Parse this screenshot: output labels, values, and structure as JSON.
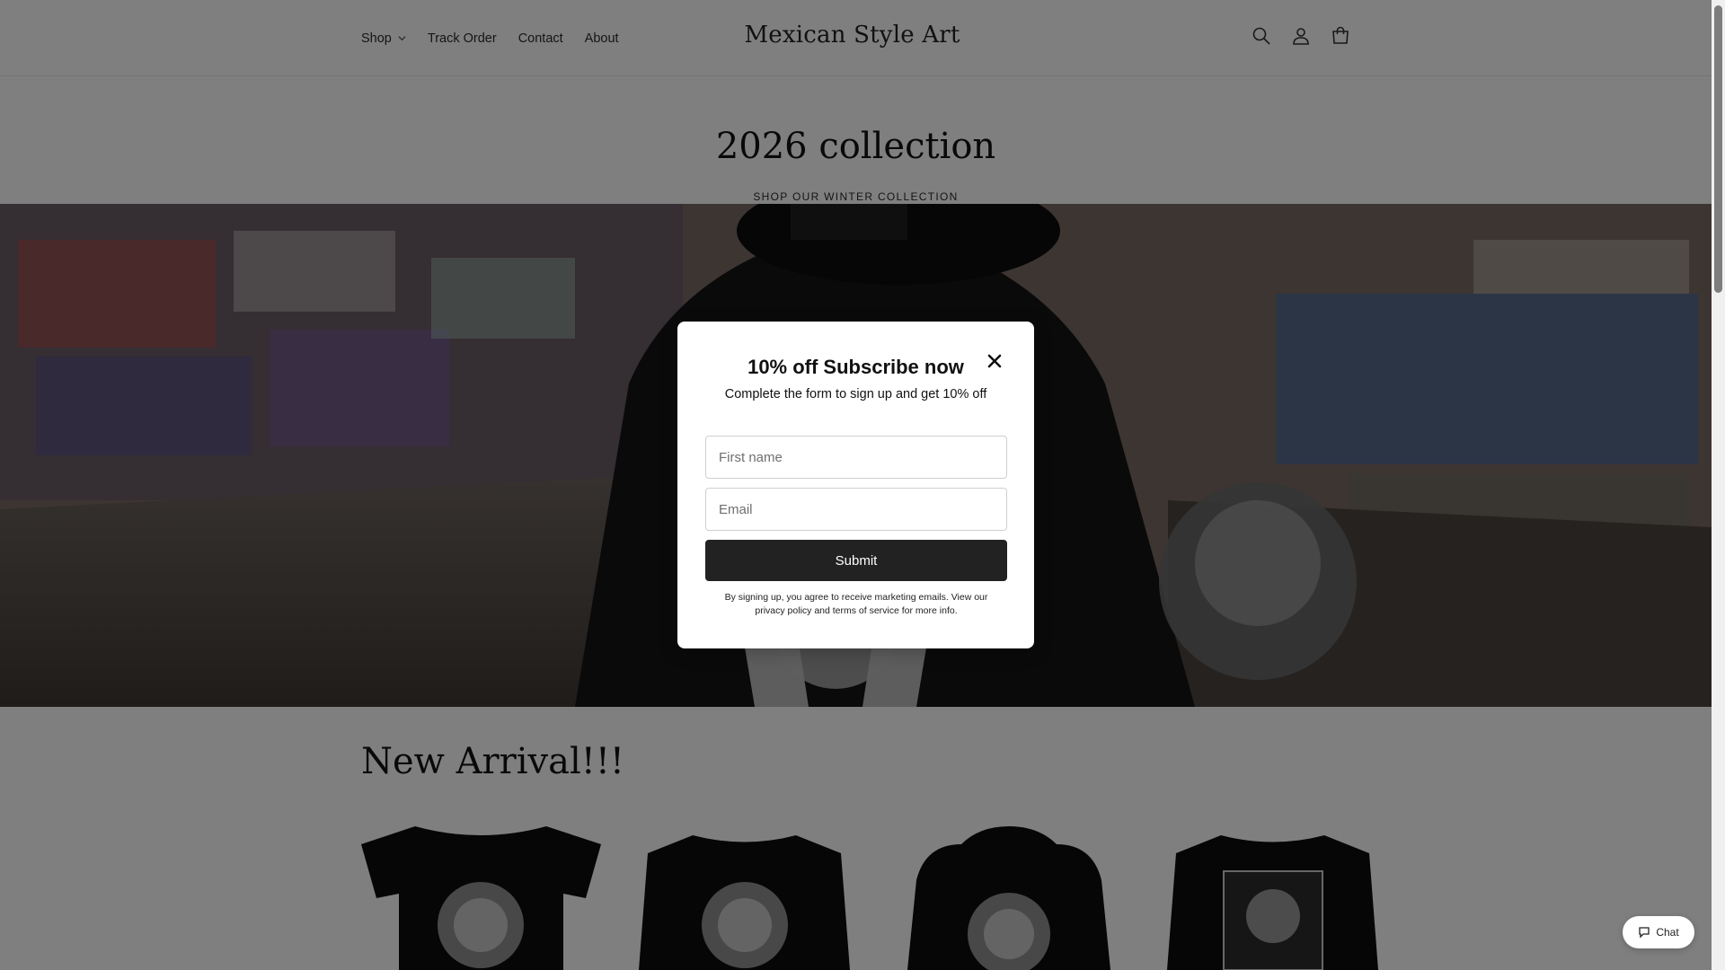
{
  "header": {
    "nav": [
      {
        "label": "Shop",
        "has_dropdown": true
      },
      {
        "label": "Track Order"
      },
      {
        "label": "Contact"
      },
      {
        "label": "About"
      }
    ],
    "logo": "Mexican Style Art",
    "icons": [
      "search-icon",
      "account-icon",
      "cart-icon"
    ]
  },
  "collection": {
    "title": "2026 collection",
    "subtitle": "SHOP OUR WINTER COLLECTION"
  },
  "arrivals": {
    "title": "New Arrival!!!"
  },
  "modal": {
    "title": "10% off Subscribe now",
    "subtitle": "Complete the form to sign up and get 10% off",
    "first_name_placeholder": "First name",
    "email_placeholder": "Email",
    "submit_label": "Submit",
    "legal": "By signing up, you agree to receive marketing emails. View our privacy policy and terms of service for more info."
  },
  "chat": {
    "label": "Chat"
  },
  "colors": {
    "button_bg": "#222222",
    "overlay": "rgba(0,0,0,0.5)"
  }
}
